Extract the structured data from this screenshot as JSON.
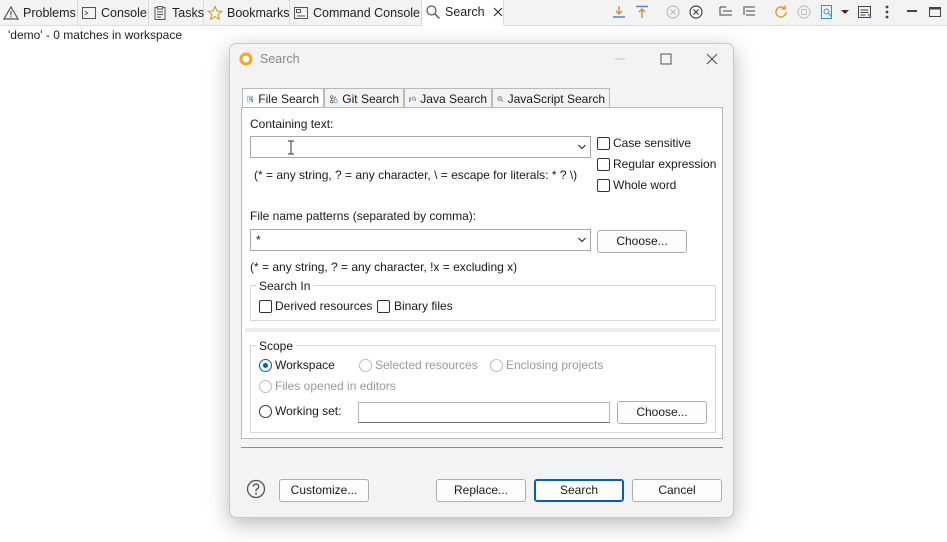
{
  "view_tabs": [
    {
      "label": "Problems",
      "icon": "warning-icon"
    },
    {
      "label": "Console",
      "icon": "console-icon"
    },
    {
      "label": "Tasks",
      "icon": "tasks-icon"
    },
    {
      "label": "Bookmarks",
      "icon": "bookmark-icon"
    },
    {
      "label": "Command Console",
      "icon": "command-console-icon"
    },
    {
      "label": "Search",
      "icon": "search-icon",
      "active": true
    }
  ],
  "status_text": "'demo' - 0 matches in workspace",
  "dialog": {
    "title": "Search",
    "tabs": [
      {
        "label": "File Search",
        "active": true
      },
      {
        "label": "Git Search"
      },
      {
        "label": "Java Search"
      },
      {
        "label": "JavaScript Search"
      }
    ],
    "containing_text_label": "Containing text:",
    "containing_text_value": "",
    "containing_hint": "(* = any string, ? = any character, \\ = escape for literals: * ? \\)",
    "options": {
      "case_sensitive": "Case sensitive",
      "regular_expression": "Regular expression",
      "whole_word": "Whole word"
    },
    "file_patterns_label": "File name patterns (separated by comma):",
    "file_patterns_value": "*",
    "file_patterns_hint": "(* = any string, ? = any character, !x = excluding x)",
    "choose_label": "Choose...",
    "search_in": {
      "title": "Search In",
      "derived": "Derived resources",
      "binary": "Binary files"
    },
    "scope": {
      "title": "Scope",
      "workspace": "Workspace",
      "selected": "Selected resources",
      "enclosing": "Enclosing projects",
      "files_opened": "Files opened in editors",
      "working_set": "Working set:",
      "working_set_value": "",
      "choose_label": "Choose..."
    },
    "buttons": {
      "customize": "Customize...",
      "replace": "Replace...",
      "search": "Search",
      "cancel": "Cancel"
    }
  },
  "colors": {
    "accent": "#005fb8",
    "dialog_bg": "#f3f3f3",
    "panel_bg": "#ffffff"
  }
}
